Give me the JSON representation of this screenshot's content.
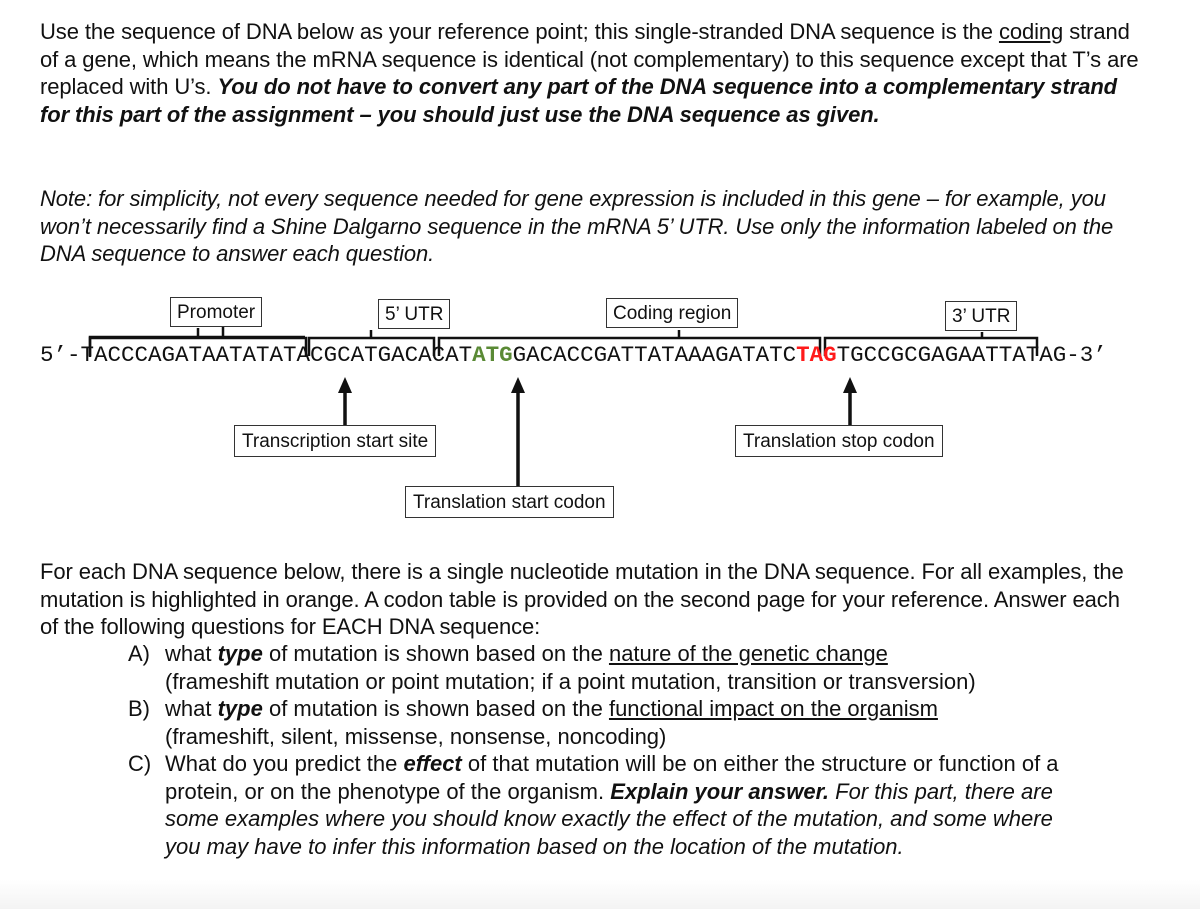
{
  "intro": {
    "p1_a": "Use the sequence of DNA below as your reference point; this single-stranded DNA sequence is the ",
    "p1_coding": "coding",
    "p1_b": " strand of a gene, which means the mRNA sequence is identical (not complementary) to this sequence except that T’s are replaced with U’s. ",
    "p1_bold": "You do not have to convert any part of the DNA sequence into a complementary strand for this part of the assignment – you should just use the DNA sequence as given.",
    "note": "Note: for simplicity, not every sequence needed for gene expression is included in this gene – for example, you won’t necessarily find a Shine Dalgarno sequence in the mRNA 5’ UTR. Use only the information labeled on the DNA sequence to answer each question."
  },
  "diagram": {
    "regions": {
      "promoter": "Promoter",
      "utr5": "5’ UTR",
      "coding": "Coding region",
      "utr3": "3’ UTR"
    },
    "sequence": {
      "prefix": "5’-",
      "promoter": "TACCCAGATAATATATAC",
      "utr5": "GCATGACACAT",
      "start_codon": "ATG",
      "coding_body": "GACACCGATTATAAAGATATC",
      "stop_codon": "TAG",
      "utr3": "TGCCGCGAGAATTATAG",
      "suffix": "-3’"
    },
    "colors": {
      "start_codon": "#5a8a35",
      "stop_codon": "#ff1a1a"
    },
    "callouts": {
      "transcription_start": "Transcription start site",
      "translation_start": "Translation start codon",
      "translation_stop": "Translation stop codon"
    }
  },
  "instructions": {
    "intro": "For each DNA sequence below, there is a single nucleotide mutation in the DNA sequence. For all examples, the mutation is highlighted in orange. A codon table is provided on the second page for your reference. Answer each of the following questions for EACH DNA sequence:",
    "items": [
      {
        "marker": "A)",
        "a": "what ",
        "b": "type",
        "c": " of mutation is shown based on the ",
        "u": "nature of the genetic change",
        "d": "(frameshift mutation or point mutation; if a point mutation, transition or transversion)"
      },
      {
        "marker": "B)",
        "a": "what ",
        "b": "type",
        "c": " of mutation is shown based on the ",
        "u": "functional impact on the organism",
        "d": "(frameshift, silent, missense, nonsense, noncoding)"
      },
      {
        "marker": "C)",
        "a": "What do you predict the ",
        "b": "effect",
        "c": " of that mutation will be on either the structure or function of a protein, or on the phenotype of the organism. ",
        "bold2": "Explain your answer.",
        "it": " For this part, there are some examples where you should know exactly the effect of the mutation, and some where you may have to infer this information based on the location of the mutation."
      }
    ]
  }
}
